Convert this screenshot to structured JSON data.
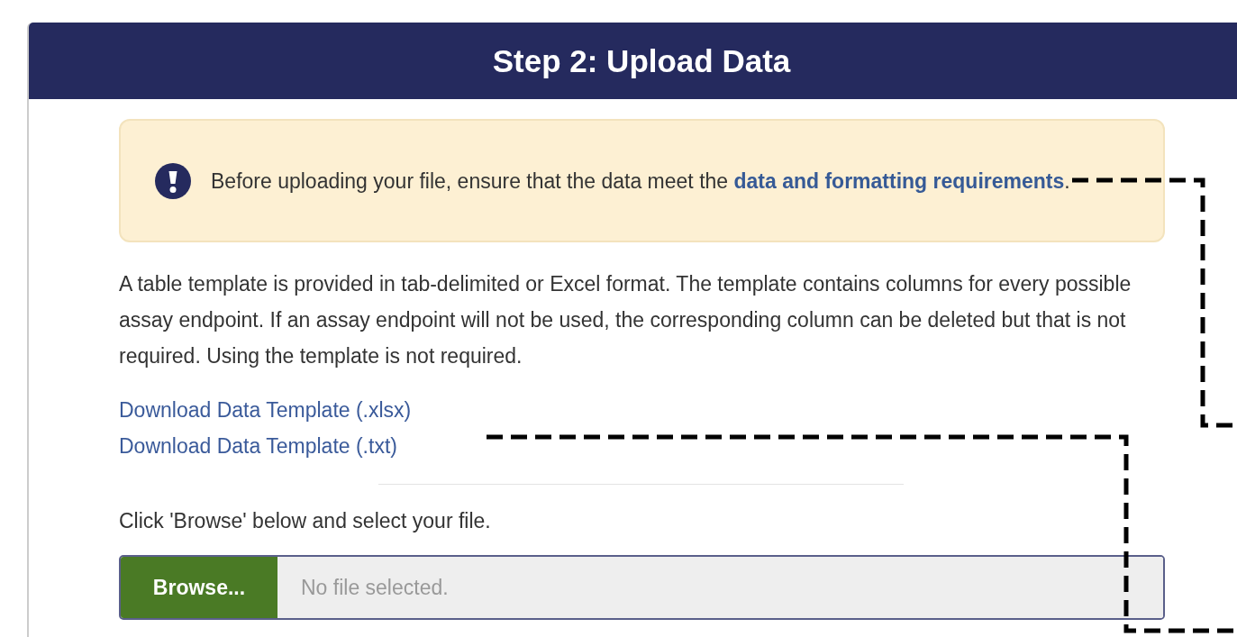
{
  "panel": {
    "title": "Step 2: Upload Data"
  },
  "alert": {
    "text": "Before uploading your file, ensure that the data meet the ",
    "link": "data and formatting requirements",
    "after": "."
  },
  "description": "A table template is provided in tab-delimited or Excel format. The template contains columns for every possible assay endpoint. If an assay endpoint will not be used, the corresponding column can be deleted but that is not required. Using the template is not required.",
  "downloads": [
    "Download Data Template (.xlsx)",
    "Download Data Template (.txt)"
  ],
  "instruction": "Click 'Browse' below and select your file.",
  "file_input": {
    "button": "Browse...",
    "placeholder": "No file selected."
  }
}
